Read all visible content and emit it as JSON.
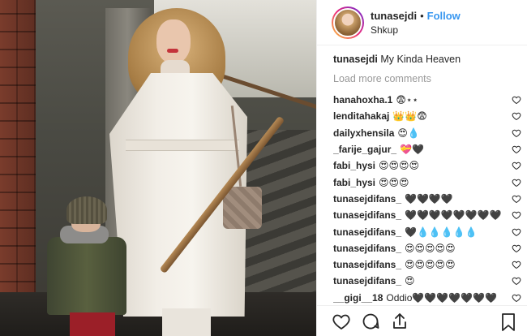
{
  "post": {
    "image_alt": "",
    "author": {
      "username": "tunasejdi",
      "separator": "•",
      "follow_label": "Follow",
      "location": "Shkup"
    },
    "caption": {
      "username": "tunasejdi",
      "text": "My Kinda Heaven"
    },
    "load_more_label": "Load more comments",
    "comments": [
      {
        "username": "hanahoxha.1",
        "text": "😨⋆⋆"
      },
      {
        "username": "lenditahakaj",
        "text": "👑👑😨"
      },
      {
        "username": "dailyxhensila",
        "text": "😍💧"
      },
      {
        "username": "_farije_gajur_",
        "text": "💝🖤"
      },
      {
        "username": "fabi_hysi",
        "text": "😍😍😍😍"
      },
      {
        "username": "fabi_hysi",
        "text": "😍😍😍"
      },
      {
        "username": "tunasejdifans_",
        "text": "🖤🖤🖤🖤"
      },
      {
        "username": "tunasejdifans_",
        "text": "🖤🖤🖤🖤🖤🖤🖤🖤"
      },
      {
        "username": "tunasejdifans_",
        "text": "🖤💧💧💧💧💧"
      },
      {
        "username": "tunasejdifans_",
        "text": "😍😍😍😍😍"
      },
      {
        "username": "tunasejdifans_",
        "text": "😍😍😍😍😍"
      },
      {
        "username": "tunasejdifans_",
        "text": "😍"
      },
      {
        "username": "__gigi__18",
        "text": "Oddio🖤🖤🖤🖤🖤🖤🖤"
      }
    ]
  },
  "actions": {
    "like_icon": "heart-outline",
    "comment_icon": "speech-bubble",
    "share_icon": "paper-plane",
    "save_icon": "bookmark"
  },
  "colors": {
    "link_blue": "#3897f0",
    "muted_gray": "#999999",
    "text": "#262626",
    "border": "#efefef"
  }
}
